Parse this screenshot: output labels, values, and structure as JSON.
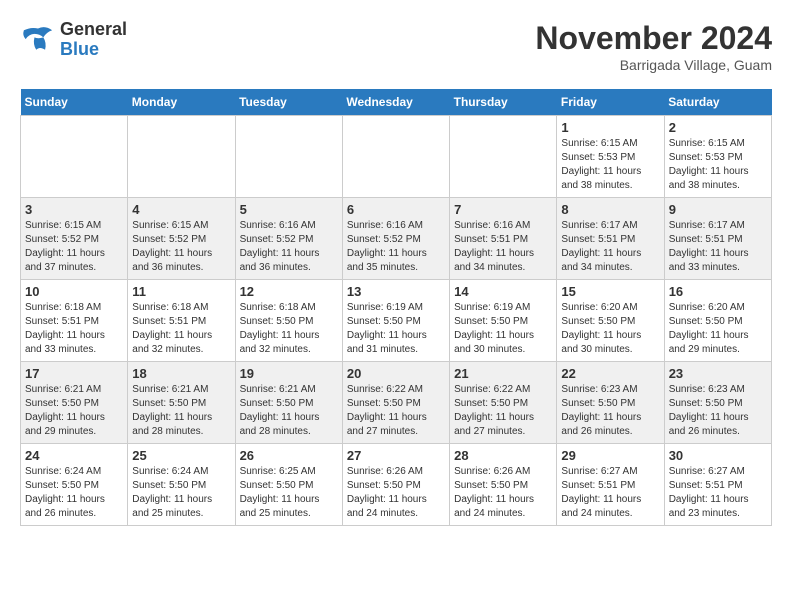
{
  "header": {
    "logo_line1": "General",
    "logo_line2": "Blue",
    "month_title": "November 2024",
    "location": "Barrigada Village, Guam"
  },
  "days_of_week": [
    "Sunday",
    "Monday",
    "Tuesday",
    "Wednesday",
    "Thursday",
    "Friday",
    "Saturday"
  ],
  "weeks": [
    [
      {
        "day": "",
        "info": ""
      },
      {
        "day": "",
        "info": ""
      },
      {
        "day": "",
        "info": ""
      },
      {
        "day": "",
        "info": ""
      },
      {
        "day": "",
        "info": ""
      },
      {
        "day": "1",
        "info": "Sunrise: 6:15 AM\nSunset: 5:53 PM\nDaylight: 11 hours\nand 38 minutes."
      },
      {
        "day": "2",
        "info": "Sunrise: 6:15 AM\nSunset: 5:53 PM\nDaylight: 11 hours\nand 38 minutes."
      }
    ],
    [
      {
        "day": "3",
        "info": "Sunrise: 6:15 AM\nSunset: 5:52 PM\nDaylight: 11 hours\nand 37 minutes."
      },
      {
        "day": "4",
        "info": "Sunrise: 6:15 AM\nSunset: 5:52 PM\nDaylight: 11 hours\nand 36 minutes."
      },
      {
        "day": "5",
        "info": "Sunrise: 6:16 AM\nSunset: 5:52 PM\nDaylight: 11 hours\nand 36 minutes."
      },
      {
        "day": "6",
        "info": "Sunrise: 6:16 AM\nSunset: 5:52 PM\nDaylight: 11 hours\nand 35 minutes."
      },
      {
        "day": "7",
        "info": "Sunrise: 6:16 AM\nSunset: 5:51 PM\nDaylight: 11 hours\nand 34 minutes."
      },
      {
        "day": "8",
        "info": "Sunrise: 6:17 AM\nSunset: 5:51 PM\nDaylight: 11 hours\nand 34 minutes."
      },
      {
        "day": "9",
        "info": "Sunrise: 6:17 AM\nSunset: 5:51 PM\nDaylight: 11 hours\nand 33 minutes."
      }
    ],
    [
      {
        "day": "10",
        "info": "Sunrise: 6:18 AM\nSunset: 5:51 PM\nDaylight: 11 hours\nand 33 minutes."
      },
      {
        "day": "11",
        "info": "Sunrise: 6:18 AM\nSunset: 5:51 PM\nDaylight: 11 hours\nand 32 minutes."
      },
      {
        "day": "12",
        "info": "Sunrise: 6:18 AM\nSunset: 5:50 PM\nDaylight: 11 hours\nand 32 minutes."
      },
      {
        "day": "13",
        "info": "Sunrise: 6:19 AM\nSunset: 5:50 PM\nDaylight: 11 hours\nand 31 minutes."
      },
      {
        "day": "14",
        "info": "Sunrise: 6:19 AM\nSunset: 5:50 PM\nDaylight: 11 hours\nand 30 minutes."
      },
      {
        "day": "15",
        "info": "Sunrise: 6:20 AM\nSunset: 5:50 PM\nDaylight: 11 hours\nand 30 minutes."
      },
      {
        "day": "16",
        "info": "Sunrise: 6:20 AM\nSunset: 5:50 PM\nDaylight: 11 hours\nand 29 minutes."
      }
    ],
    [
      {
        "day": "17",
        "info": "Sunrise: 6:21 AM\nSunset: 5:50 PM\nDaylight: 11 hours\nand 29 minutes."
      },
      {
        "day": "18",
        "info": "Sunrise: 6:21 AM\nSunset: 5:50 PM\nDaylight: 11 hours\nand 28 minutes."
      },
      {
        "day": "19",
        "info": "Sunrise: 6:21 AM\nSunset: 5:50 PM\nDaylight: 11 hours\nand 28 minutes."
      },
      {
        "day": "20",
        "info": "Sunrise: 6:22 AM\nSunset: 5:50 PM\nDaylight: 11 hours\nand 27 minutes."
      },
      {
        "day": "21",
        "info": "Sunrise: 6:22 AM\nSunset: 5:50 PM\nDaylight: 11 hours\nand 27 minutes."
      },
      {
        "day": "22",
        "info": "Sunrise: 6:23 AM\nSunset: 5:50 PM\nDaylight: 11 hours\nand 26 minutes."
      },
      {
        "day": "23",
        "info": "Sunrise: 6:23 AM\nSunset: 5:50 PM\nDaylight: 11 hours\nand 26 minutes."
      }
    ],
    [
      {
        "day": "24",
        "info": "Sunrise: 6:24 AM\nSunset: 5:50 PM\nDaylight: 11 hours\nand 26 minutes."
      },
      {
        "day": "25",
        "info": "Sunrise: 6:24 AM\nSunset: 5:50 PM\nDaylight: 11 hours\nand 25 minutes."
      },
      {
        "day": "26",
        "info": "Sunrise: 6:25 AM\nSunset: 5:50 PM\nDaylight: 11 hours\nand 25 minutes."
      },
      {
        "day": "27",
        "info": "Sunrise: 6:26 AM\nSunset: 5:50 PM\nDaylight: 11 hours\nand 24 minutes."
      },
      {
        "day": "28",
        "info": "Sunrise: 6:26 AM\nSunset: 5:50 PM\nDaylight: 11 hours\nand 24 minutes."
      },
      {
        "day": "29",
        "info": "Sunrise: 6:27 AM\nSunset: 5:51 PM\nDaylight: 11 hours\nand 24 minutes."
      },
      {
        "day": "30",
        "info": "Sunrise: 6:27 AM\nSunset: 5:51 PM\nDaylight: 11 hours\nand 23 minutes."
      }
    ]
  ]
}
